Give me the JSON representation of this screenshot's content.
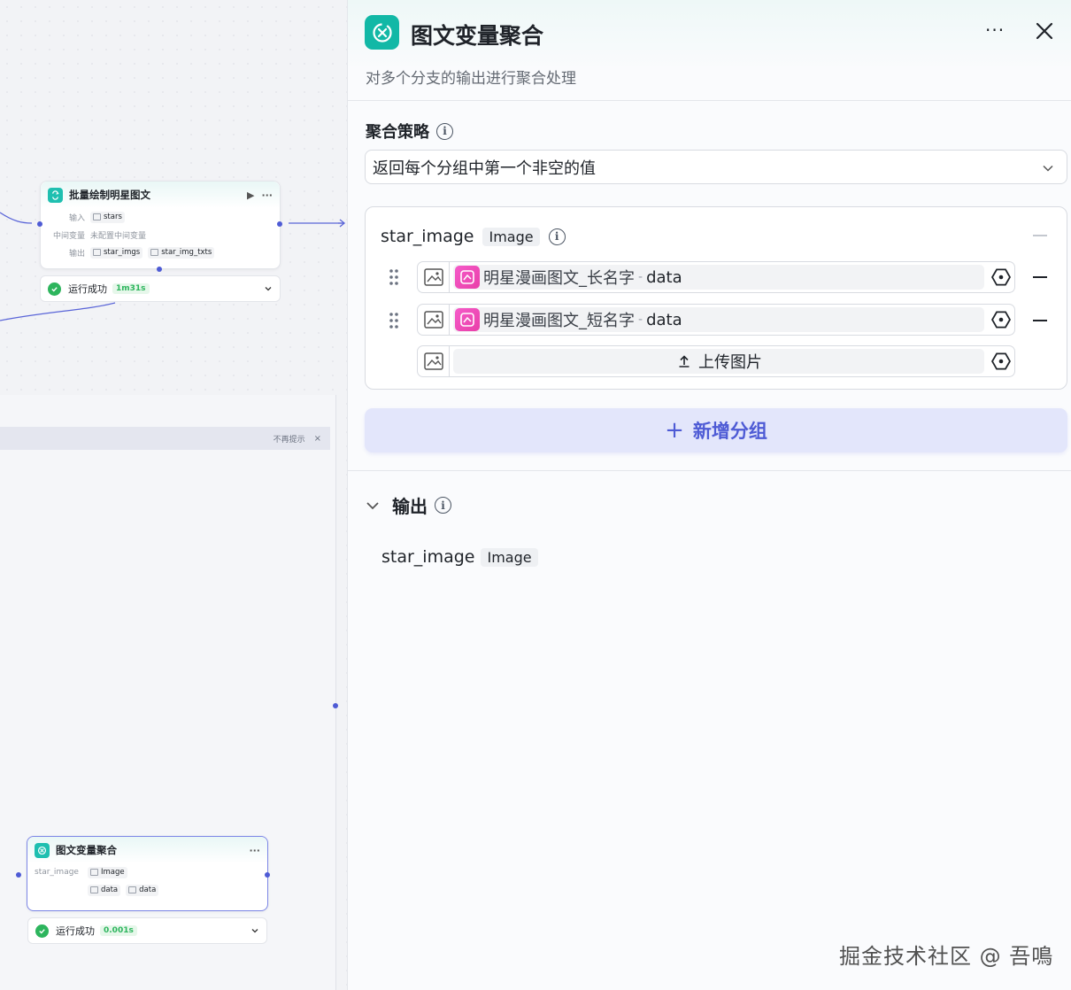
{
  "canvas": {
    "batch_node": {
      "title": "批量绘制明星图文",
      "run_icon": "play-icon",
      "more": "···",
      "input_label": "输入",
      "input_tag": "stars",
      "mid_label": "中间变量",
      "mid_value": "未配置中间变量",
      "output_label": "输出",
      "output_tags": [
        "star_imgs",
        "star_img_txts"
      ],
      "status": "运行成功",
      "duration": "1m31s"
    },
    "tip": {
      "text": "不再提示",
      "close": "×"
    },
    "agg_node": {
      "title": "图文变量聚合",
      "more": "···",
      "var_name": "star_image",
      "var_type": "Image",
      "sources": [
        "data",
        "data"
      ],
      "status": "运行成功",
      "duration": "0.001s"
    }
  },
  "panel": {
    "title": "图文变量聚合",
    "description": "对多个分支的输出进行聚合处理",
    "more": "···",
    "strategy": {
      "label": "聚合策略",
      "selected": "返回每个分组中第一个非空的值"
    },
    "group": {
      "name": "star_image",
      "type": "Image",
      "variables": [
        {
          "source": "明星漫画图文_长名字",
          "sep": "-",
          "field": "data"
        },
        {
          "source": "明星漫画图文_短名字",
          "sep": "-",
          "field": "data"
        }
      ],
      "upload_label": "上传图片"
    },
    "add_group_label": "新增分组",
    "add_group_plus": "+",
    "output": {
      "label": "输出",
      "name": "star_image",
      "type": "Image"
    }
  },
  "watermark": "掘金技术社区 @ 吾鳴",
  "colors": {
    "accent": "#4e5bd5",
    "node_teal": "#12b8a6",
    "success": "#2db55d",
    "pink": "#e93fa8"
  }
}
